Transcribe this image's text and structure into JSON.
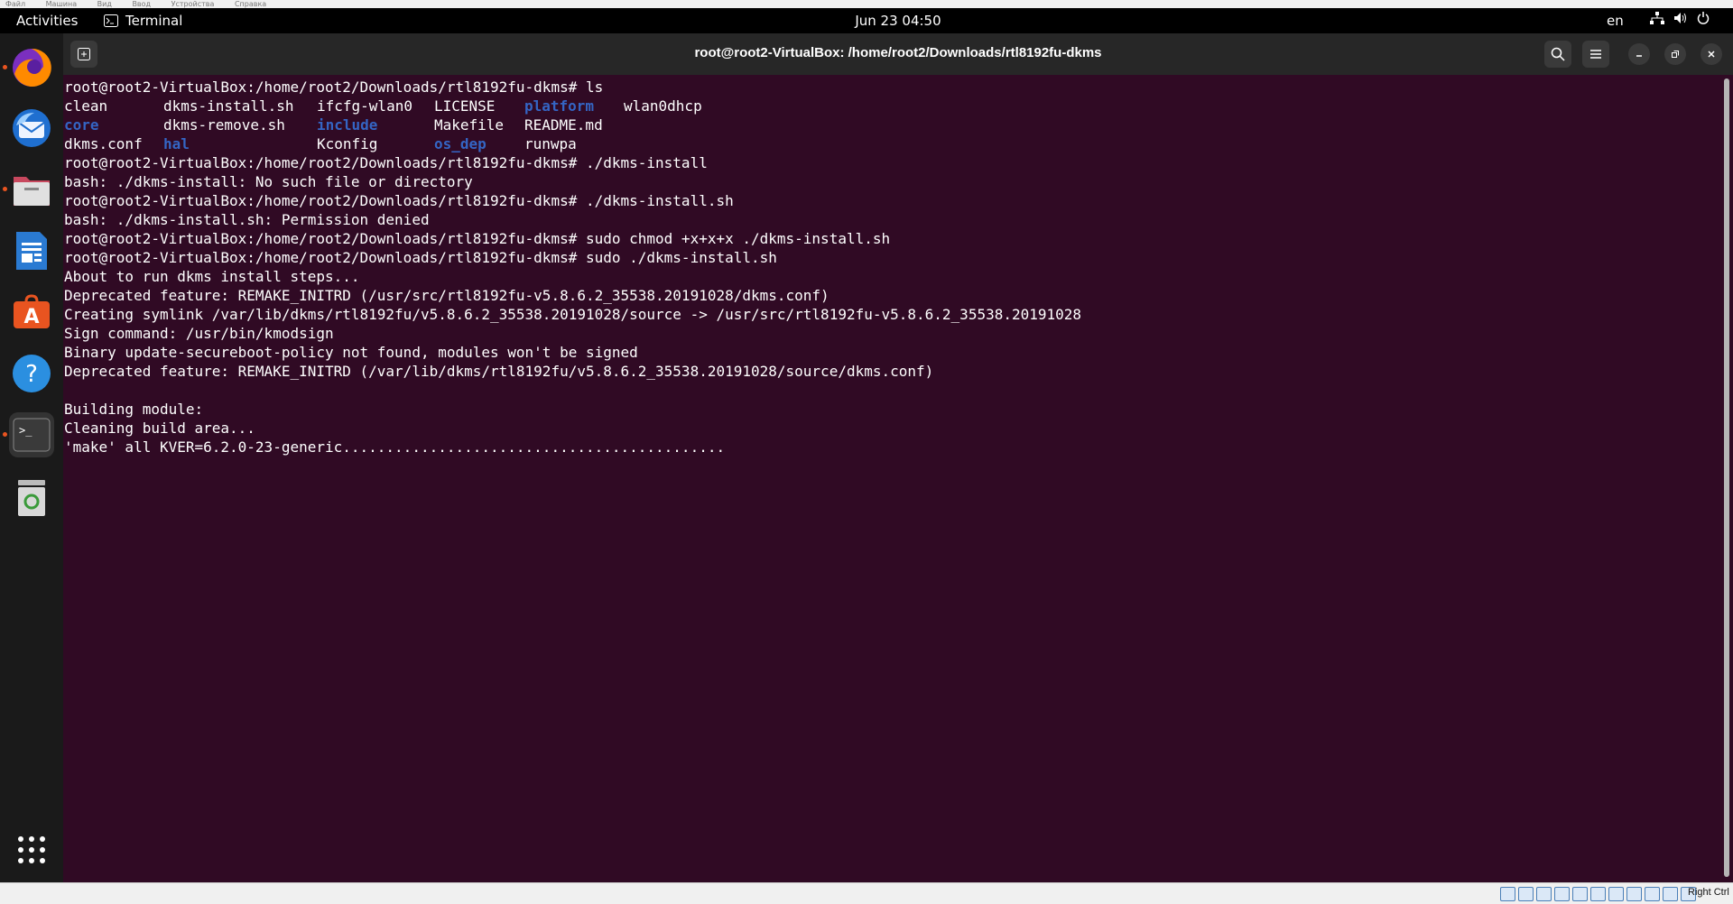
{
  "vbox_menu": [
    "Файл",
    "Машина",
    "Вид",
    "Ввод",
    "Устройства",
    "Справка"
  ],
  "topbar": {
    "activities": "Activities",
    "app_name": "Terminal",
    "clock": "Jun 23  04:50",
    "lang": "en",
    "tray_icons": [
      "network-icon",
      "volume-icon",
      "power-icon"
    ]
  },
  "dock": {
    "items": [
      {
        "name": "Firefox",
        "icon": "firefox-icon",
        "running": true
      },
      {
        "name": "Thunderbird",
        "icon": "thunderbird-icon",
        "running": false
      },
      {
        "name": "Files",
        "icon": "files-icon",
        "running": true
      },
      {
        "name": "LibreOffice Writer",
        "icon": "writer-icon",
        "running": false
      },
      {
        "name": "Ubuntu Software",
        "icon": "software-icon",
        "running": false
      },
      {
        "name": "Help",
        "icon": "help-icon",
        "running": false
      },
      {
        "name": "Terminal",
        "icon": "terminal-icon",
        "running": true
      },
      {
        "name": "Trash",
        "icon": "trash-icon",
        "running": false
      }
    ],
    "show_apps": "grid-icon"
  },
  "window": {
    "title": "root@root2-VirtualBox: /home/root2/Downloads/rtl8192fu-dkms"
  },
  "terminal": {
    "prompt": "root@root2-VirtualBox:/home/root2/Downloads/rtl8192fu-dkms#",
    "cmd_ls": "ls",
    "ls_rows": [
      [
        {
          "t": "clean",
          "d": false
        },
        {
          "t": "dkms-install.sh",
          "d": false
        },
        {
          "t": "ifcfg-wlan0",
          "d": false
        },
        {
          "t": "LICENSE",
          "d": false
        },
        {
          "t": "platform",
          "d": true
        },
        {
          "t": "wlan0dhcp",
          "d": false
        }
      ],
      [
        {
          "t": "core",
          "d": true
        },
        {
          "t": "dkms-remove.sh",
          "d": false
        },
        {
          "t": "include",
          "d": true
        },
        {
          "t": "Makefile",
          "d": false
        },
        {
          "t": "README.md",
          "d": false
        },
        {
          "t": "",
          "d": false
        }
      ],
      [
        {
          "t": "dkms.conf",
          "d": false
        },
        {
          "t": "hal",
          "d": true
        },
        {
          "t": "Kconfig",
          "d": false
        },
        {
          "t": "os_dep",
          "d": true
        },
        {
          "t": "runwpa",
          "d": false
        },
        {
          "t": "",
          "d": false
        }
      ]
    ],
    "lines": [
      "root@root2-VirtualBox:/home/root2/Downloads/rtl8192fu-dkms# ./dkms-install",
      "bash: ./dkms-install: No such file or directory",
      "root@root2-VirtualBox:/home/root2/Downloads/rtl8192fu-dkms# ./dkms-install.sh",
      "bash: ./dkms-install.sh: Permission denied",
      "root@root2-VirtualBox:/home/root2/Downloads/rtl8192fu-dkms# sudo chmod +x+x+x ./dkms-install.sh",
      "root@root2-VirtualBox:/home/root2/Downloads/rtl8192fu-dkms# sudo ./dkms-install.sh",
      "About to run dkms install steps...",
      "Deprecated feature: REMAKE_INITRD (/usr/src/rtl8192fu-v5.8.6.2_35538.20191028/dkms.conf)",
      "Creating symlink /var/lib/dkms/rtl8192fu/v5.8.6.2_35538.20191028/source -> /usr/src/rtl8192fu-v5.8.6.2_35538.20191028",
      "Sign command: /usr/bin/kmodsign",
      "Binary update-secureboot-policy not found, modules won't be signed",
      "Deprecated feature: REMAKE_INITRD (/var/lib/dkms/rtl8192fu/v5.8.6.2_35538.20191028/source/dkms.conf)",
      "",
      "Building module:",
      "Cleaning build area...",
      "'make' all KVER=6.2.0-23-generic............................................"
    ]
  },
  "statusbar": {
    "host_key": "Right Ctrl"
  }
}
